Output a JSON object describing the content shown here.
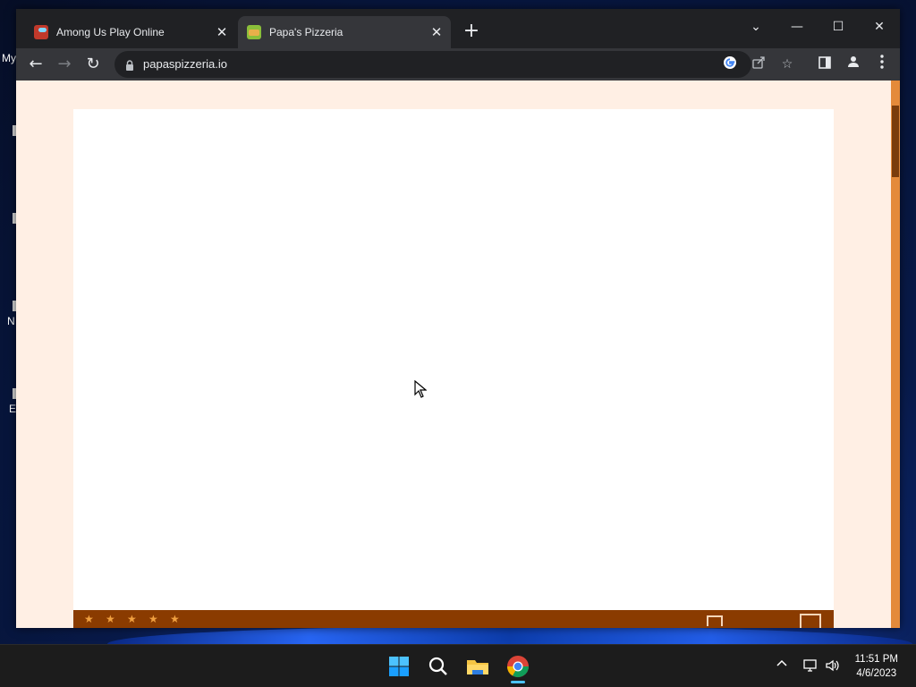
{
  "desktop": {
    "labels": [
      "My",
      "N",
      "E"
    ]
  },
  "browser": {
    "tabs": [
      {
        "title": "Among Us Play Online",
        "favicon": "among-us-icon",
        "active": false
      },
      {
        "title": "Papa's Pizzeria",
        "favicon": "pizzeria-icon",
        "active": true
      }
    ],
    "close_glyph": "✕",
    "new_tab_glyph": "+",
    "window_controls": {
      "tab_search": "⌄",
      "minimize": "—",
      "maximize": "☐",
      "close": "✕"
    },
    "url": "papaspizzeria.io",
    "nav": {
      "back": "←",
      "forward": "→",
      "reload": "↻"
    },
    "omnibox_icons": [
      "google-icon",
      "share-icon",
      "bookmark-star-icon"
    ],
    "toolbar_icons": [
      "side-panel-icon",
      "profile-icon",
      "menu-icon"
    ]
  },
  "page": {
    "background": "#ffefe4",
    "accent": "#e48a3a",
    "game_bar_color": "#8a3b00",
    "star_count": 5
  },
  "taskbar": {
    "apps": [
      "windows-start-icon",
      "search-icon",
      "file-explorer-icon",
      "chrome-icon"
    ],
    "time": "11:51 PM",
    "date": "4/6/2023"
  }
}
